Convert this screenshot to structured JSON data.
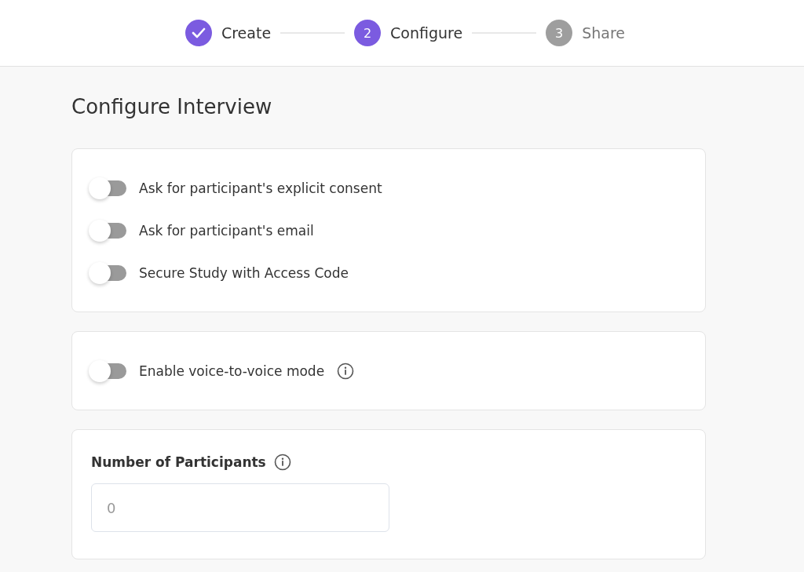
{
  "steps": [
    {
      "label": "Create",
      "kind": "done"
    },
    {
      "number": "2",
      "label": "Configure",
      "kind": "current"
    },
    {
      "number": "3",
      "label": "Share",
      "kind": "upcoming"
    }
  ],
  "title": "Configure Interview",
  "cards": [
    {
      "kind": "toggles",
      "toggles": [
        {
          "label": "Ask for participant's explicit consent",
          "on": false,
          "info": false
        },
        {
          "label": "Ask for participant's email",
          "on": false,
          "info": false
        },
        {
          "label": "Secure Study with Access Code",
          "on": false,
          "info": false
        }
      ]
    },
    {
      "kind": "toggles",
      "toggles": [
        {
          "label": "Enable voice-to-voice mode",
          "on": false,
          "info": true
        }
      ]
    },
    {
      "kind": "field",
      "label": "Number of Participants",
      "info": true,
      "placeholder": "0"
    }
  ]
}
